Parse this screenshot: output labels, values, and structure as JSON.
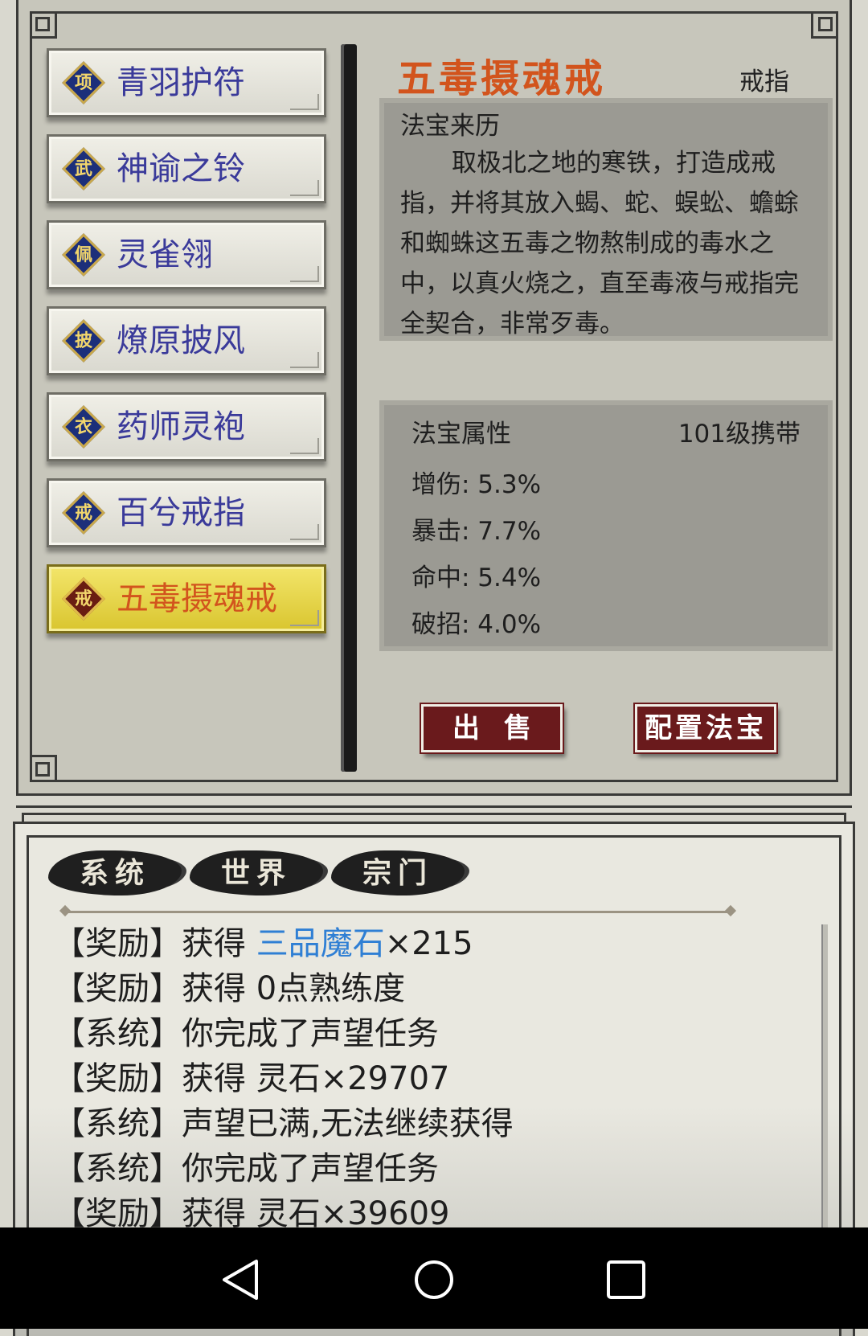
{
  "items": [
    {
      "glyph": "项",
      "label": "青羽护符"
    },
    {
      "glyph": "武",
      "label": "神谕之铃"
    },
    {
      "glyph": "佩",
      "label": "灵雀翎"
    },
    {
      "glyph": "披",
      "label": "燎原披风"
    },
    {
      "glyph": "衣",
      "label": "药师灵袍"
    },
    {
      "glyph": "戒",
      "label": "百兮戒指"
    },
    {
      "glyph": "戒",
      "label": "五毒摄魂戒",
      "selected": true
    }
  ],
  "detail": {
    "title": "五毒摄魂戒",
    "type": "戒指",
    "origin_heading": "法宝来历",
    "origin_text": "取极北之地的寒铁，打造成戒指，并将其放入蝎、蛇、蜈蚣、蟾蜍和蜘蛛这五毒之物熬制成的毒水之中，以真火烧之，直至毒液与戒指完全契合，非常歹毒。",
    "attr_heading": "法宝属性",
    "attr_level": "101级携带",
    "attributes": [
      "增伤: 5.3%",
      "暴击: 7.7%",
      "命中: 5.4%",
      "破招: 4.0%"
    ],
    "sell_button": "出售",
    "equip_button": "配置法宝"
  },
  "chat": {
    "tabs": [
      "系统",
      "世界",
      "宗门"
    ],
    "messages": [
      {
        "prefix": "【奖励】获得 ",
        "highlight": "三品魔石",
        "suffix": "×215"
      },
      {
        "prefix": "【奖励】获得 0点熟练度",
        "highlight": "",
        "suffix": ""
      },
      {
        "prefix": "【系统】你完成了声望任务",
        "highlight": "",
        "suffix": ""
      },
      {
        "prefix": "【奖励】获得 灵石×29707",
        "highlight": "",
        "suffix": ""
      },
      {
        "prefix": "【系统】声望已满,无法继续获得",
        "highlight": "",
        "suffix": ""
      },
      {
        "prefix": "【系统】你完成了声望任务",
        "highlight": "",
        "suffix": ""
      },
      {
        "prefix": "【奖励】获得 灵石×39609",
        "highlight": "",
        "suffix": ""
      }
    ]
  },
  "colors": {
    "selected_title": "#d2541d",
    "item_label": "#3a3a9a",
    "highlight": "#2f7fd4",
    "button_bg": "#6a1a1c"
  },
  "icons": {
    "nav_back": "back-triangle-icon",
    "nav_home": "home-circle-icon",
    "nav_recent": "recent-square-icon"
  }
}
